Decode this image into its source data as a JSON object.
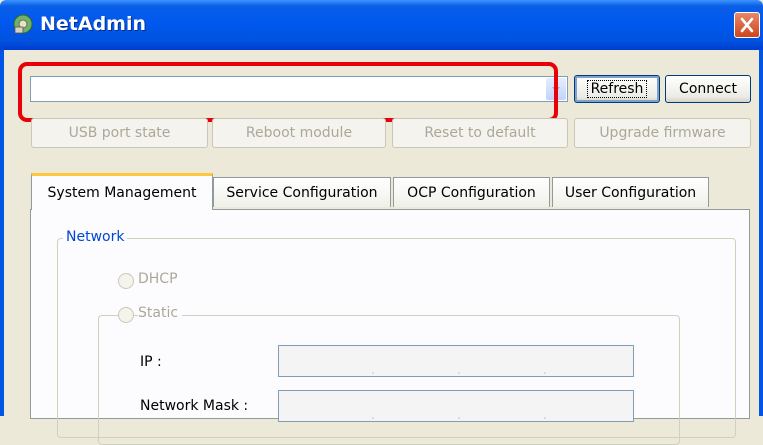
{
  "window": {
    "title": "NetAdmin",
    "icon": "network-admin-icon",
    "close_icon": "close-icon"
  },
  "device_select": {
    "value": "",
    "arrow_icon": "chevron-down-icon"
  },
  "toolbar": {
    "refresh_label": "Refresh",
    "connect_label": "Connect",
    "usb_port_state_label": "USB port state",
    "reboot_module_label": "Reboot module",
    "reset_to_default_label": "Reset to default",
    "upgrade_firmware_label": "Upgrade firmware"
  },
  "tabs": [
    {
      "label": "System Management",
      "active": true
    },
    {
      "label": "Service Configuration",
      "active": false
    },
    {
      "label": "OCP Configuration",
      "active": false
    },
    {
      "label": "User Configuration",
      "active": false
    }
  ],
  "network": {
    "group_label": "Network",
    "dhcp_label": "DHCP",
    "static_label": "Static",
    "ip_label": "IP :",
    "network_mask_label": "Network Mask :",
    "ip_value": [
      "",
      "",
      "",
      ""
    ],
    "network_mask_value": [
      "",
      "",
      "",
      ""
    ]
  },
  "colors": {
    "titlebar": "#0055E5",
    "highlight": "#E8000B",
    "group_label": "#0046D5",
    "disabled_text": "#ACA899"
  }
}
